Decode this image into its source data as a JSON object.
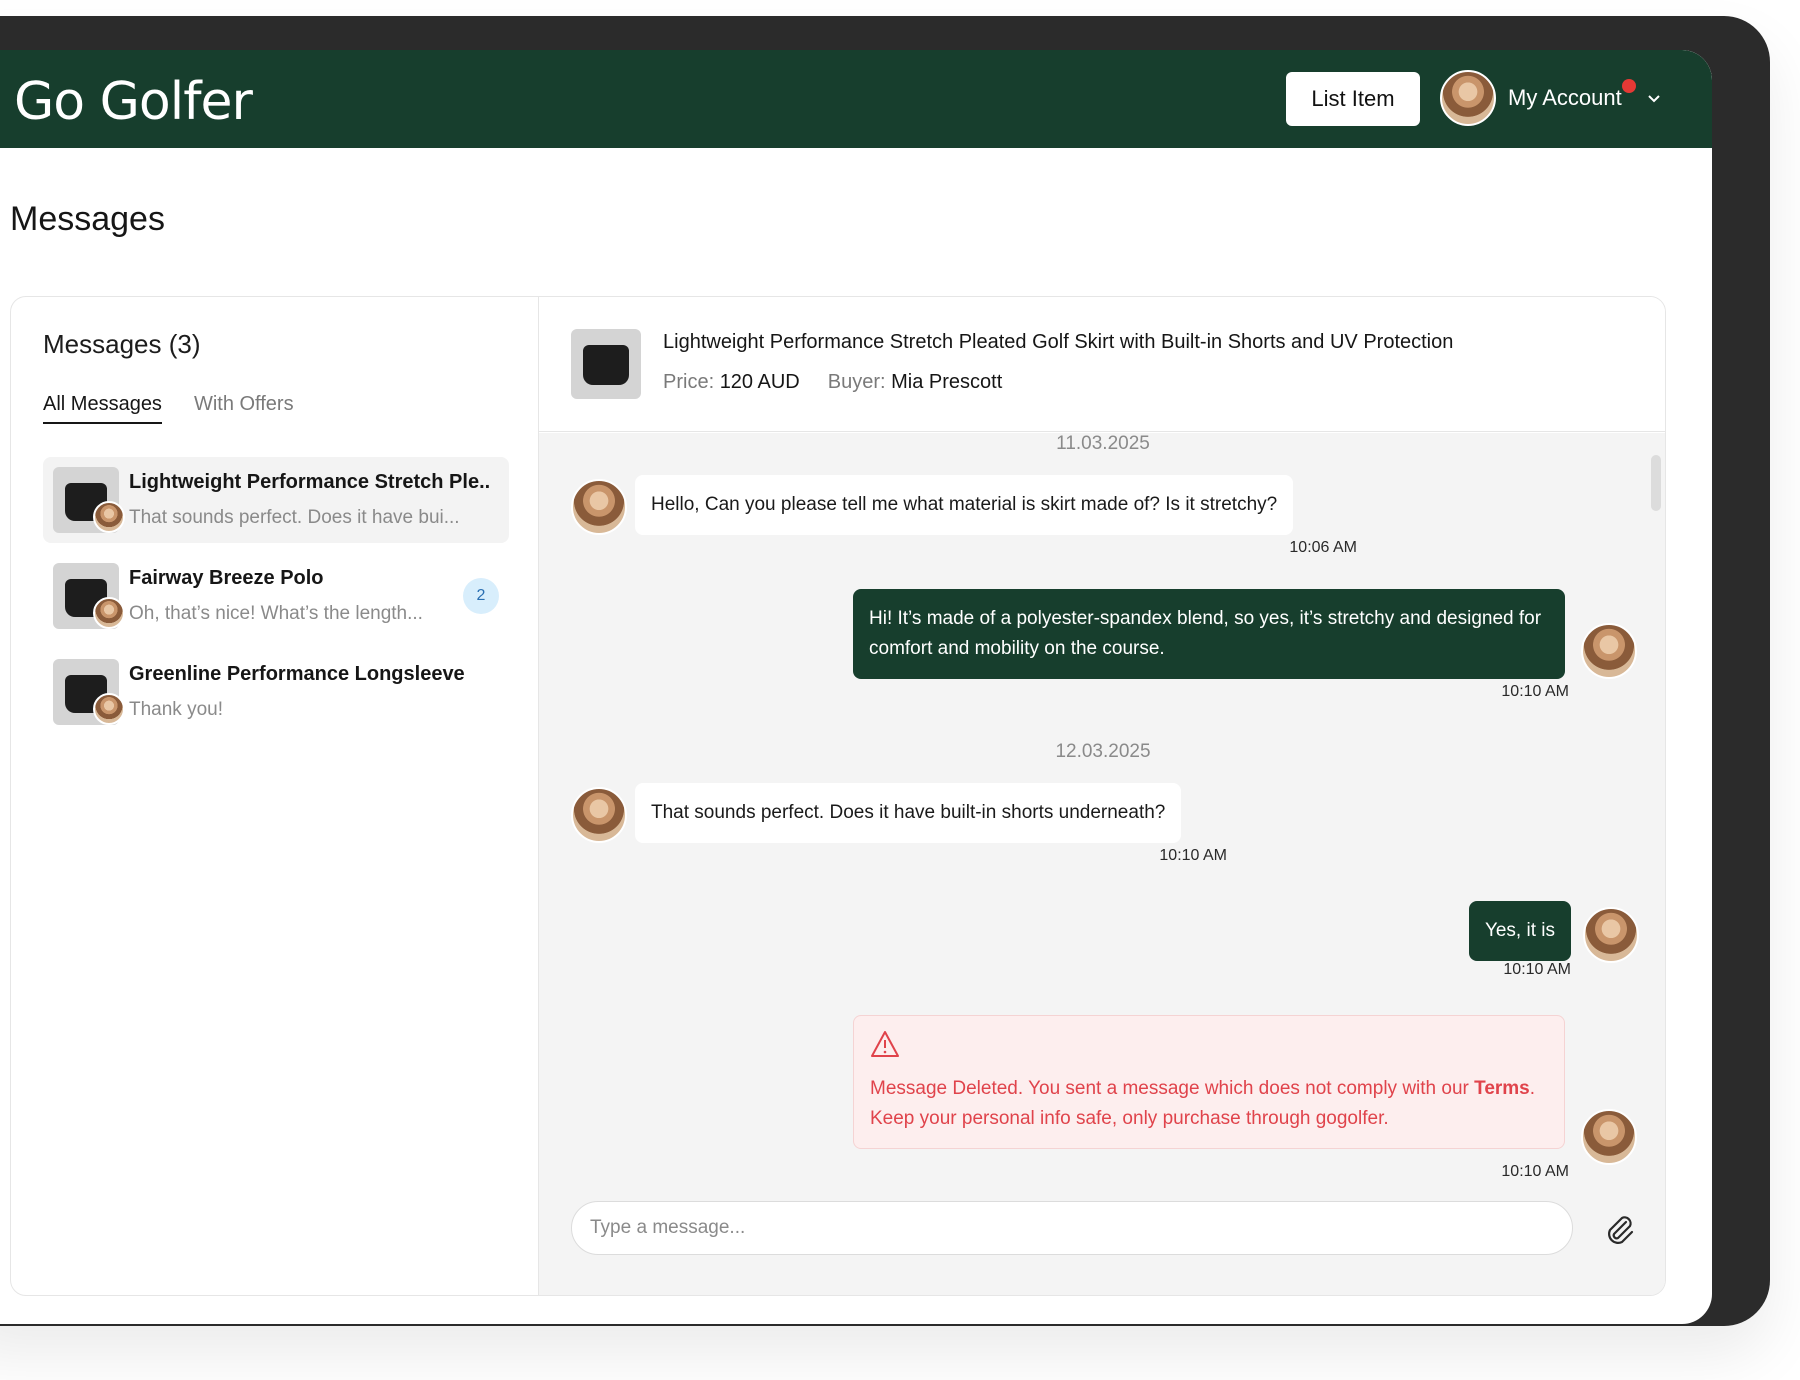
{
  "header": {
    "logo": "Go Golfer",
    "list_item_label": "List Item",
    "account_label": "My Account"
  },
  "page": {
    "title": "Messages"
  },
  "sidebar": {
    "title": "Messages (3)",
    "tabs": [
      {
        "label": "All Messages",
        "active": true
      },
      {
        "label": "With Offers",
        "active": false
      }
    ],
    "conversations": [
      {
        "title": "Lightweight Performance Stretch Ple...",
        "preview": "That sounds perfect. Does it have bui...",
        "badge": ""
      },
      {
        "title": "Fairway Breeze Polo",
        "preview": "Oh, that’s nice! What’s the length...",
        "badge": "2"
      },
      {
        "title": "Greenline Performance Longsleeve",
        "preview": "Thank you!",
        "badge": ""
      }
    ]
  },
  "item": {
    "title": "Lightweight Performance Stretch Pleated Golf Skirt with Built-in Shorts and UV Protection",
    "price_label": "Price:",
    "price": "120 AUD",
    "buyer_label": "Buyer:",
    "buyer": "Mia Prescott"
  },
  "chat": {
    "dates": [
      "11.03.2025",
      "12.03.2025"
    ],
    "messages": [
      {
        "dir": "in",
        "text": "Hello, Can you please tell me what material is skirt made of? Is it stretchy?",
        "time": "10:06 AM"
      },
      {
        "dir": "out",
        "text": "Hi! It’s made of a polyester-spandex blend, so yes, it’s stretchy and designed for comfort and mobility on the course.",
        "time": "10:10 AM"
      },
      {
        "dir": "in",
        "text": "That sounds perfect. Does it have built-in shorts underneath?",
        "time": "10:10 AM"
      },
      {
        "dir": "out",
        "text": "Yes, it is",
        "time": "10:10 AM"
      }
    ],
    "deleted_notice": {
      "text_before": "Message Deleted. You sent a message which does not comply with our ",
      "link": "Terms",
      "text_after": ". Keep your personal info safe, only purchase through gogolfer.",
      "time": "10:10 AM"
    },
    "composer_placeholder": "Type a message..."
  },
  "colors": {
    "brand": "#173e2d",
    "alert": "#e0434b",
    "badge": "#d8eefc"
  },
  "icons": {
    "attachment": "paperclip-icon",
    "warning": "warning-icon",
    "dropdown": "chevron-down-icon"
  }
}
